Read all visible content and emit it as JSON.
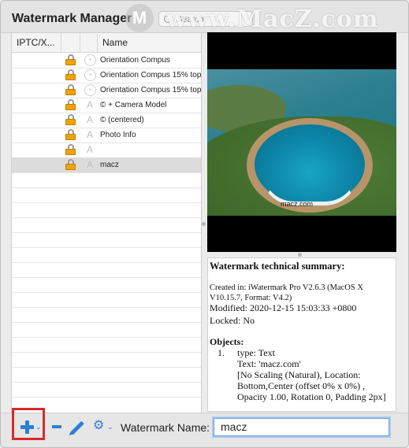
{
  "window": {
    "title": "Watermark Manager"
  },
  "search": {
    "placeholder": "Search"
  },
  "overlay_watermark": {
    "logo_letter": "M",
    "text": "www.MacZ.com"
  },
  "table": {
    "columns": [
      "IPTC/X...",
      "",
      "Name"
    ],
    "rows": [
      {
        "icon": "compass-icon",
        "name": "Orientation Compus",
        "selected": false
      },
      {
        "icon": "compass-icon",
        "name": "Orientation Compus 15% top",
        "selected": false
      },
      {
        "icon": "compass-icon",
        "name": "Orientation Compus 15% top",
        "selected": false
      },
      {
        "icon": "text-a-icon",
        "name": "© + Camera Model",
        "selected": false
      },
      {
        "icon": "text-a-icon",
        "name": "© (centered)",
        "selected": false
      },
      {
        "icon": "text-a-icon",
        "name": "Photo Info",
        "selected": false
      },
      {
        "icon": "text-a-icon",
        "name": "",
        "selected": false
      },
      {
        "icon": "text-a-icon",
        "name": "macz",
        "selected": true
      }
    ],
    "empty_rows": 15
  },
  "preview": {
    "watermark_text": "macz.com"
  },
  "summary": {
    "title": "Watermark technical summary:",
    "created": "Created in: iWatermark Pro V2.6.3 (MacOS X V10.15.7, Format: V4.2)",
    "modified": "Modified: 2020-12-15 15:03:33 +0800",
    "locked": "Locked: No",
    "objects_title": "Objects:",
    "object_number": "1.",
    "object_lines": [
      "type: Text",
      "Text: 'macz.com'",
      "[No Scaling (Natural), Location:",
      "Bottom,Center (offset 0% x 0%) ,",
      "Opacity 1.00, Rotation 0, Padding 2px]"
    ]
  },
  "toolbar": {
    "chevron": "⌄",
    "watermark_name_label": "Watermark Name:",
    "watermark_name_value": "macz"
  },
  "colors": {
    "accent": "#2d7ed6",
    "highlight": "#d62b2b",
    "lock": "#f0a400"
  }
}
